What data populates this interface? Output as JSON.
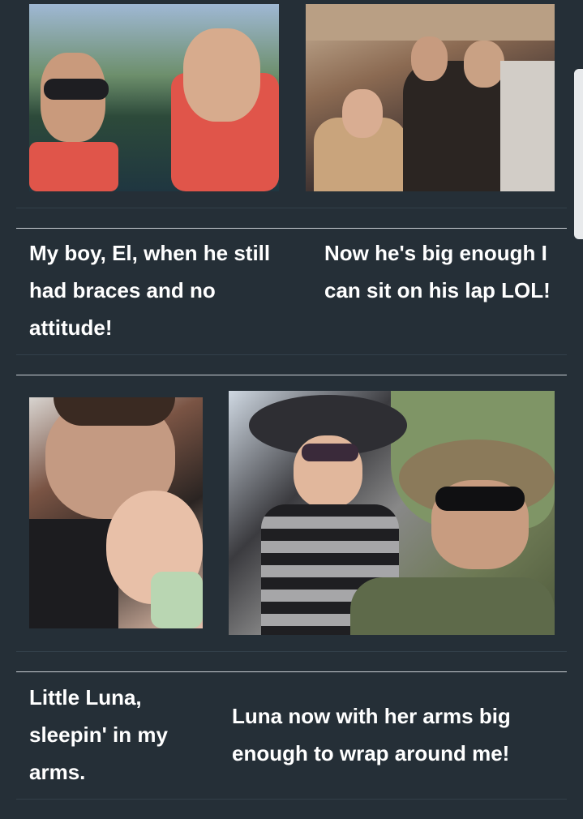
{
  "gallery": {
    "rows": [
      {
        "items": [
          {
            "photo_alt": "",
            "caption": "My boy, El, when he still had braces and no attitude!"
          },
          {
            "photo_alt": "",
            "caption": "Now he's big enough I can sit on his lap LOL!"
          }
        ]
      },
      {
        "items": [
          {
            "photo_alt": "",
            "caption": "Little Luna, sleepin' in my arms."
          },
          {
            "photo_alt": "",
            "caption": "Luna now with her arms big enough to wrap around me!"
          }
        ]
      }
    ]
  },
  "colors": {
    "background": "#252f37",
    "divider": "#c9ced3",
    "caption_text": "#ffffff"
  }
}
